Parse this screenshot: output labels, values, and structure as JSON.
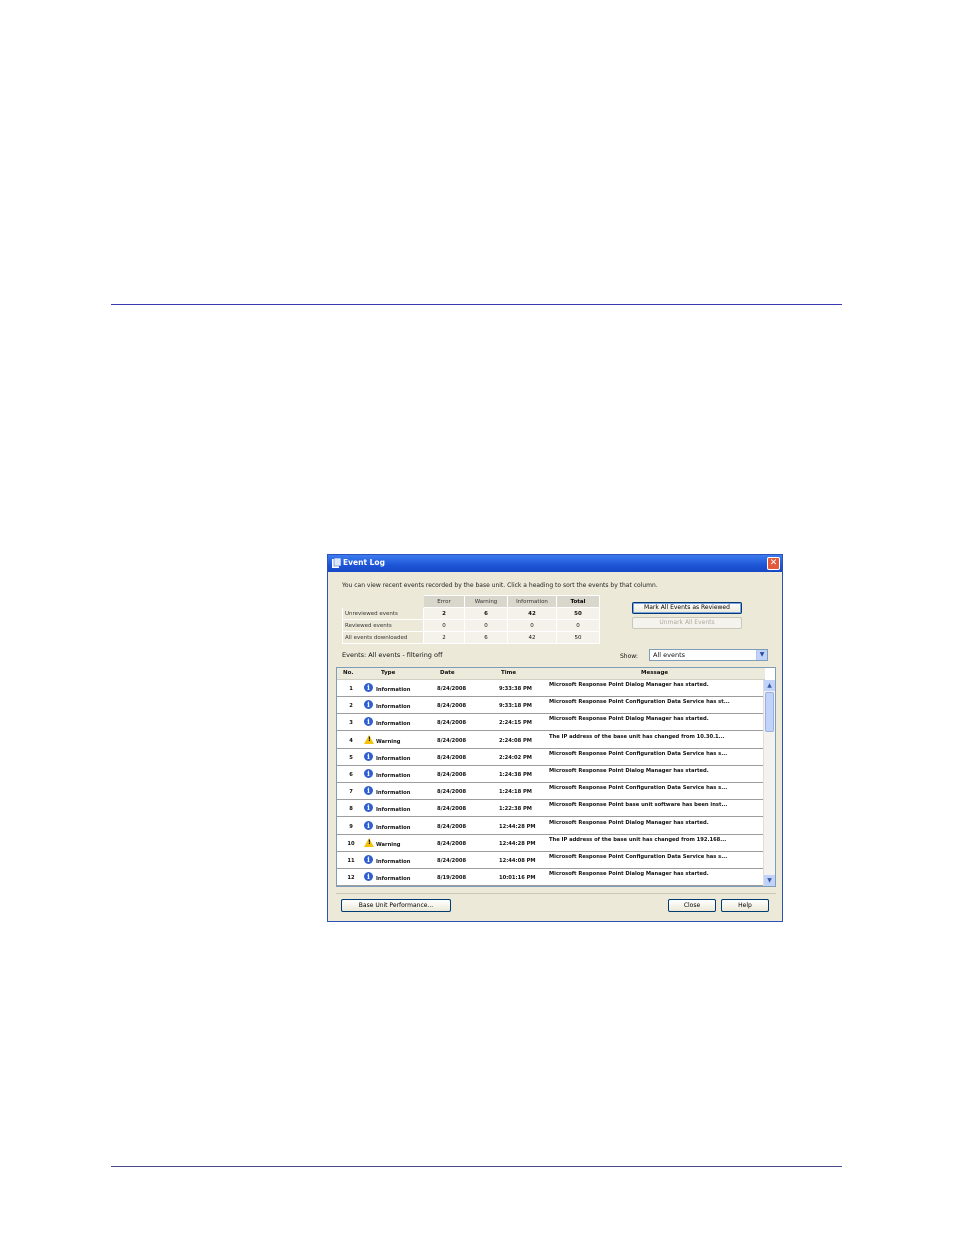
{
  "window": {
    "title": "Event Log",
    "intro": "You can view recent events recorded by the base unit. Click a heading to sort the events by that column."
  },
  "summary": {
    "headers": [
      "Error",
      "Warning",
      "Information",
      "Total"
    ],
    "rows": [
      {
        "label": "Unreviewed events",
        "values": [
          "2",
          "6",
          "42",
          "50"
        ]
      },
      {
        "label": "Reviewed events",
        "values": [
          "0",
          "0",
          "0",
          "0"
        ]
      },
      {
        "label": "All events downloaded",
        "values": [
          "2",
          "6",
          "42",
          "50"
        ]
      }
    ]
  },
  "buttons": {
    "mark_all": "Mark All Events as Reviewed",
    "unmark_all": "Unmark All Events",
    "base_unit_performance": "Base Unit Performance...",
    "close": "Close",
    "help": "Help"
  },
  "filter": {
    "events_label": "Events: All events - filtering off",
    "show_label": "Show:",
    "show_value": "All events"
  },
  "columns": [
    "No.",
    "Type",
    "Date",
    "Time",
    "Message"
  ],
  "events": [
    {
      "no": "1",
      "icon": "info-icon",
      "type": "Information",
      "date": "8/24/2008",
      "time": "9:33:38 PM",
      "message": "Microsoft Response Point Dialog Manager has started."
    },
    {
      "no": "2",
      "icon": "info-icon",
      "type": "Information",
      "date": "8/24/2008",
      "time": "9:33:18 PM",
      "message": "Microsoft Response Point Configuration Data Service has st..."
    },
    {
      "no": "3",
      "icon": "info-icon",
      "type": "Information",
      "date": "8/24/2008",
      "time": "2:24:15 PM",
      "message": "Microsoft Response Point Dialog Manager has started."
    },
    {
      "no": "4",
      "icon": "warning-icon",
      "type": "Warning",
      "date": "8/24/2008",
      "time": "2:24:08 PM",
      "message": "The IP address of the base unit has changed from 10.30.1..."
    },
    {
      "no": "5",
      "icon": "info-icon",
      "type": "Information",
      "date": "8/24/2008",
      "time": "2:24:02 PM",
      "message": "Microsoft Response Point Configuration Data Service has s..."
    },
    {
      "no": "6",
      "icon": "info-icon",
      "type": "Information",
      "date": "8/24/2008",
      "time": "1:24:38 PM",
      "message": "Microsoft Response Point Dialog Manager has started."
    },
    {
      "no": "7",
      "icon": "info-icon",
      "type": "Information",
      "date": "8/24/2008",
      "time": "1:24:18 PM",
      "message": "Microsoft Response Point Configuration Data Service has s..."
    },
    {
      "no": "8",
      "icon": "info-icon",
      "type": "Information",
      "date": "8/24/2008",
      "time": "1:22:38 PM",
      "message": "Microsoft Response Point base unit software has been inst..."
    },
    {
      "no": "9",
      "icon": "info-icon",
      "type": "Information",
      "date": "8/24/2008",
      "time": "12:44:28 PM",
      "message": "Microsoft Response Point Dialog Manager has started."
    },
    {
      "no": "10",
      "icon": "warning-icon",
      "type": "Warning",
      "date": "8/24/2008",
      "time": "12:44:28 PM",
      "message": "The IP address of the base unit has changed from 192.168..."
    },
    {
      "no": "11",
      "icon": "info-icon",
      "type": "Information",
      "date": "8/24/2008",
      "time": "12:44:08 PM",
      "message": "Microsoft Response Point Configuration Data Service has s..."
    },
    {
      "no": "12",
      "icon": "info-icon",
      "type": "Information",
      "date": "8/19/2008",
      "time": "10:01:16 PM",
      "message": "Microsoft Response Point Dialog Manager has started."
    }
  ]
}
